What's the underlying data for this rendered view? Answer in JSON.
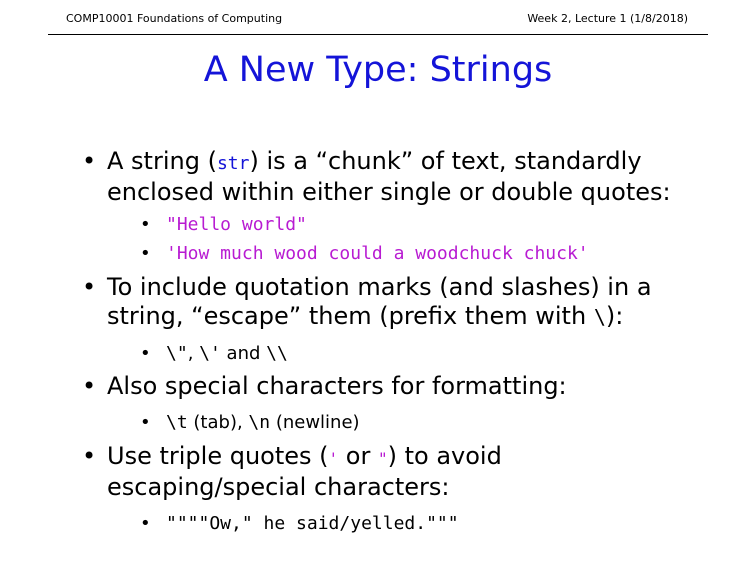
{
  "header": {
    "course": "COMP10001 Foundations of Computing",
    "week": "Week 2, Lecture 1 (1/8/2018)"
  },
  "title": "A New Type: Strings",
  "bullet_char": "•",
  "items": {
    "item1": {
      "line1_prefix": "A string (",
      "line1_code": "str",
      "line1_suffix": ") is a “chunk” of text, standardly",
      "line2": "enclosed within either single or double quotes:",
      "sub1": "\"Hello world\"",
      "sub2": "'How much wood could a woodchuck chuck'"
    },
    "item2": {
      "line1": "To include quotation marks (and slashes) in a",
      "line2_prefix": "string, “escape” them (prefix them with ",
      "line2_code": "\\",
      "line2_suffix": "):",
      "sub1_a": "\\\"",
      "sub1_b": ", ",
      "sub1_c": "\\'",
      "sub1_d": " and ",
      "sub1_e": "\\\\"
    },
    "item3": {
      "line1": "Also special characters for formatting:",
      "sub1_a": "\\t",
      "sub1_b": " (tab), ",
      "sub1_c": "\\n",
      "sub1_d": " (newline)"
    },
    "item4": {
      "line1_prefix": "Use triple quotes (",
      "line1_code1": "'",
      "line1_mid": " or ",
      "line1_code2": "\"",
      "line1_suffix": ") to avoid",
      "line2": "escaping/special characters:",
      "sub1": "\"\"\"\"Ow,\" he said/yelled.\"\"\""
    }
  }
}
